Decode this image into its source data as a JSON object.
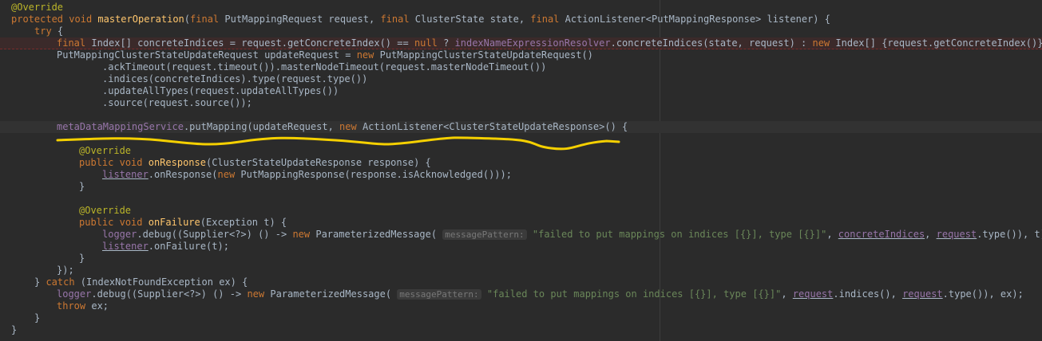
{
  "code": {
    "annotation_override": "@Override",
    "kw_protected": "protected",
    "kw_void": "void",
    "kw_final": "final",
    "kw_try": "try",
    "kw_null": "null",
    "kw_new": "new",
    "kw_public": "public",
    "kw_catch": "catch",
    "kw_throw": "throw",
    "method_master": "masterOperation",
    "method_onResponse": "onResponse",
    "method_onFailure": "onFailure",
    "hint_label": "messagePattern:",
    "failed_msg": "\"failed to put mappings on indices [{}], type [{}]\"",
    "line2_a": "(",
    "line2_b": " PutMappingRequest request, ",
    "line2_c": " ClusterState state, ",
    "line2_d": " ActionListener<PutMappingResponse> listener) {",
    "line3_b": " {",
    "line4_b": " Index[] concreteIndices = request.getConcreteIndex() == ",
    "line4_c": " ? ",
    "line4_d": "indexNameExpressionResolver",
    "line4_e": ".concreteIndices(state, request) : ",
    "line4_f": " Index[] {request.getConcreteIndex()};",
    "line5_a": "PutMappingClusterStateUpdateRequest updateRequest = ",
    "line5_b": " PutMappingClusterStateUpdateRequest()",
    "line6": ".ackTimeout(request.timeout()).masterNodeTimeout(request.masterNodeTimeout())",
    "line7": ".indices(concreteIndices).type(request.type())",
    "line8": ".updateAllTypes(request.updateAllTypes())",
    "line9": ".source(request.source());",
    "line11_a": "metaDataMappingService",
    "line11_b": ".putMapping(updateRequest, ",
    "line11_c": " ActionListener<ClusterStateUpdateResponse>() {",
    "line13_b": "(ClusterStateUpdateResponse response) {",
    "line14_a": "listener",
    "line14_b": ".onResponse(",
    "line14_c": " PutMappingResponse(response.isAcknowledged()));",
    "close_brace": "}",
    "line18_b": "(Exception t) {",
    "line19_a": "logger",
    "line19_b": ".debug((Supplier<?>) () -> ",
    "line19_c": " ParameterizedMessage( ",
    "line19_e": ", ",
    "line19_f": "concreteIndices",
    "line19_g": "request",
    "line19_h": ".type()), t);",
    "line20_a": "listener",
    "line20_b": ".onFailure(t);",
    "line22": "});",
    "line23_a": "} ",
    "line23_b": " (IndexNotFoundException ex) {",
    "line24_a": "logger",
    "line24_b": ".debug((Supplier<?>) () -> ",
    "line24_c": " ParameterizedMessage( ",
    "line24_e": ", ",
    "line24_f": "request",
    "line24_g": ".indices(), ",
    "line24_h": "request",
    "line24_i": ".type()), ex);",
    "line25_b": " ex;"
  },
  "colors": {
    "background": "#2b2b2b",
    "keyword": "#cc7832",
    "annotation": "#bbb529",
    "method_decl": "#ffc66d",
    "string": "#6a8759",
    "field": "#9876aa",
    "scribble": "#f5d000"
  }
}
